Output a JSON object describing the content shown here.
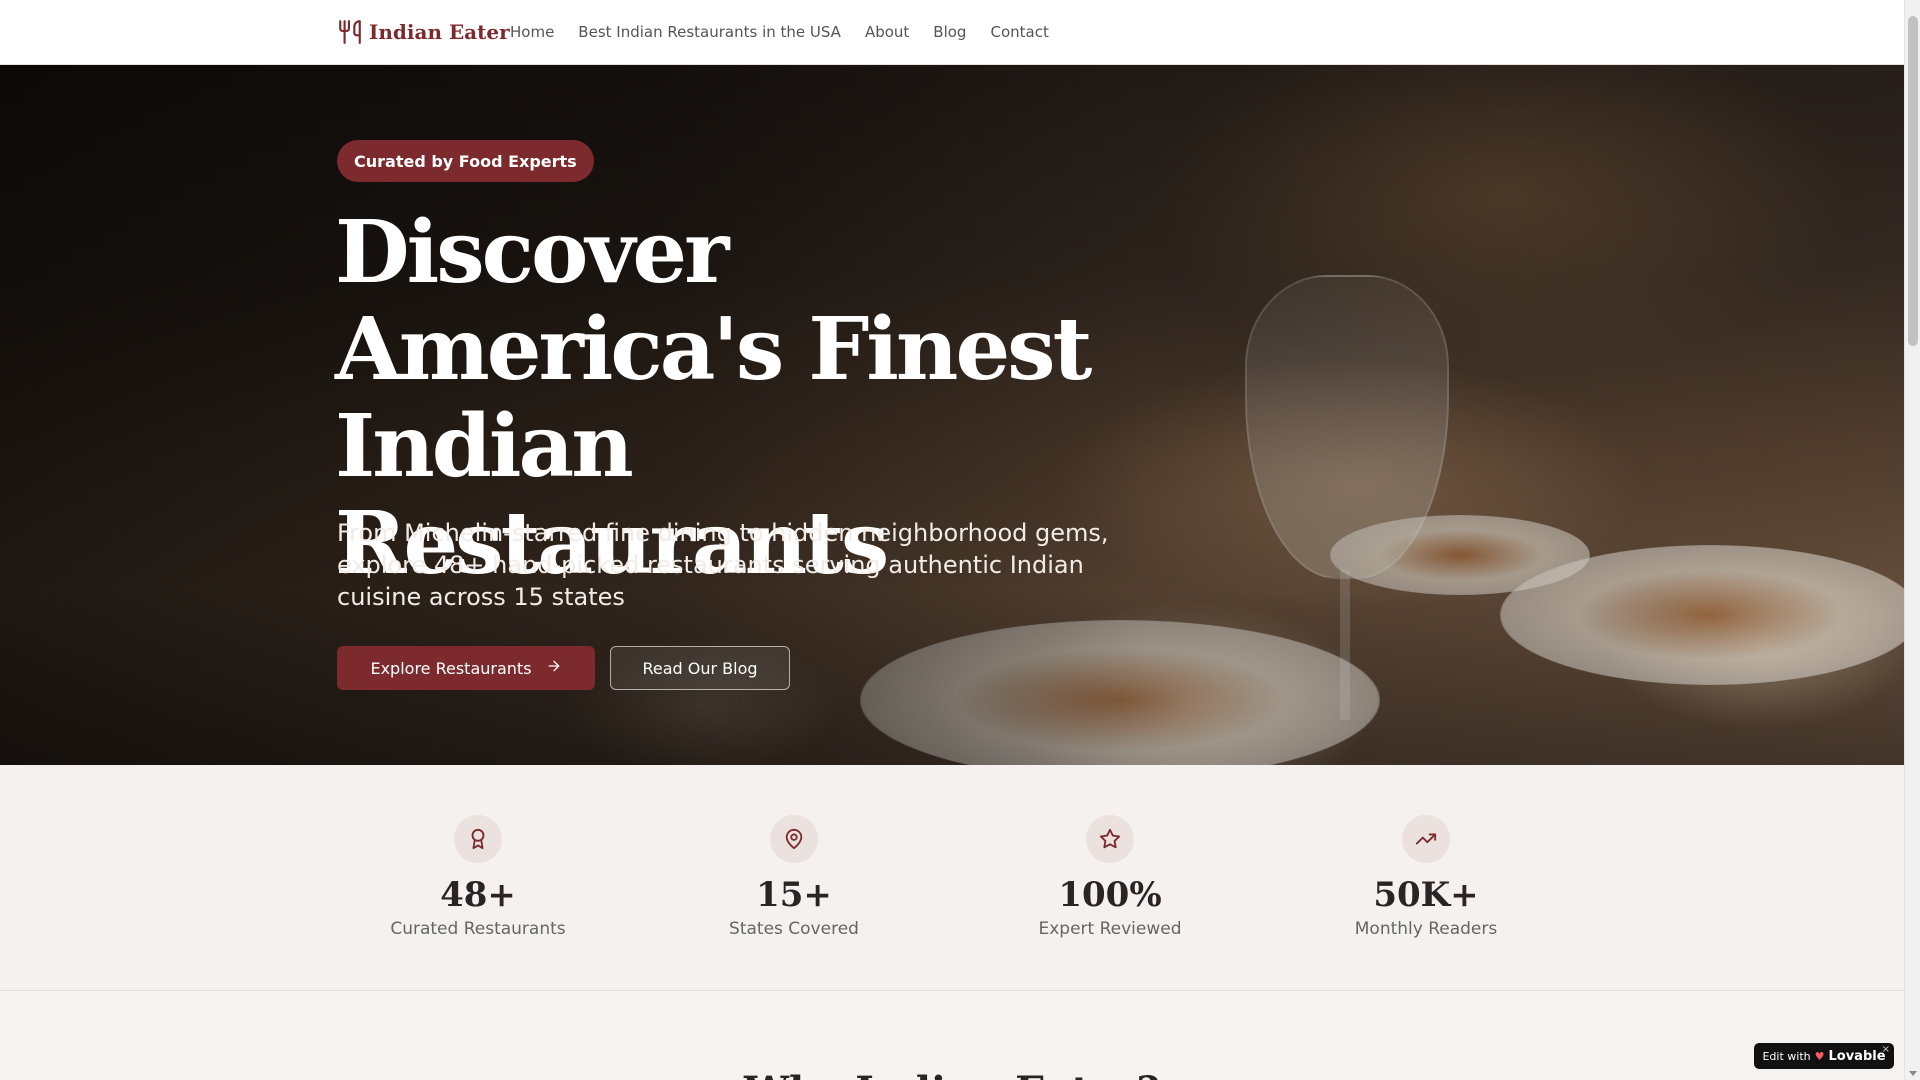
{
  "nav": {
    "brand": "Indian Eater",
    "links": [
      "Home",
      "Best Indian Restaurants in the USA",
      "About",
      "Blog",
      "Contact"
    ]
  },
  "hero": {
    "badge": "Curated by Food Experts",
    "title": "Discover America's Finest Indian Restaurants",
    "subtitle": "From Michelin-starred fine dining to hidden neighborhood gems, explore 48+ hand-picked restaurants serving authentic Indian cuisine across 15 states",
    "primary_button": "Explore Restaurants",
    "secondary_button": "Read Our Blog"
  },
  "stats": [
    {
      "icon": "award-icon",
      "value": "48+",
      "label": "Curated Restaurants"
    },
    {
      "icon": "map-pin-icon",
      "value": "15+",
      "label": "States Covered"
    },
    {
      "icon": "star-icon",
      "value": "100%",
      "label": "Expert Reviewed"
    },
    {
      "icon": "trending-up-icon",
      "value": "50K+",
      "label": "Monthly Readers"
    }
  ],
  "next_section": {
    "title": "Why Indian Eater?"
  },
  "lovable_badge": {
    "prefix": "Edit with",
    "brand": "Lovable",
    "close": "×"
  },
  "colors": {
    "accent": "#7d2a2e",
    "page_bg": "#f4f1ef",
    "icon_circle": "#ebe1de"
  }
}
